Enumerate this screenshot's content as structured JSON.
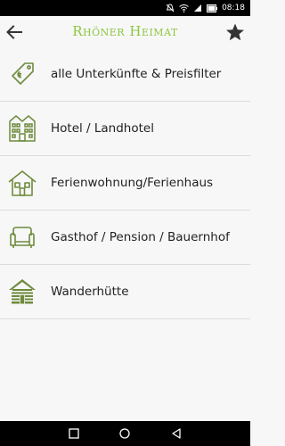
{
  "status_bar": {
    "time": "08:18"
  },
  "app_bar": {
    "title": "Rhöner Heimat"
  },
  "menu": {
    "items": [
      {
        "label": "alle Unterkünfte & Preisfilter",
        "icon": "price-tag-icon"
      },
      {
        "label": "Hotel / Landhotel",
        "icon": "hotel-building-icon"
      },
      {
        "label": "Ferienwohnung/Ferienhaus",
        "icon": "holiday-house-icon"
      },
      {
        "label": "Gasthof / Pension / Bauernhof",
        "icon": "armchair-icon"
      },
      {
        "label": "Wanderhütte",
        "icon": "log-cabin-icon"
      }
    ]
  },
  "colors": {
    "accent": "#8cc63f",
    "icon_green": "#6e8b3d",
    "divider": "#dcdcdc"
  }
}
